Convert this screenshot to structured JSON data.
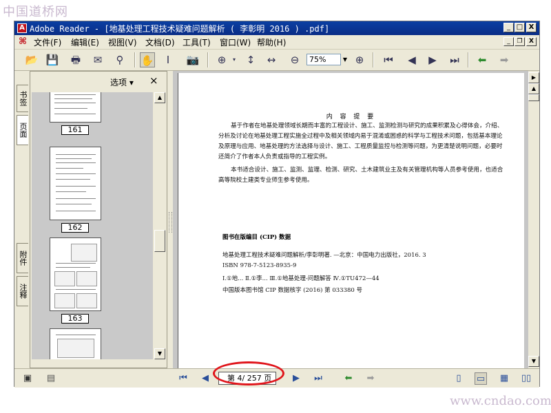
{
  "watermark": {
    "top": "中国道桥网",
    "bottom": "www.cndao.com"
  },
  "window": {
    "title": "Adobe Reader - [地基处理工程技术疑难问题解析 ( 李彰明 2016 ) .pdf]",
    "controls": {
      "minimize": "_",
      "maximize": "□",
      "close": "X"
    }
  },
  "menu": {
    "items": [
      "文件(F)",
      "编辑(E)",
      "视图(V)",
      "文档(D)",
      "工具(T)",
      "窗口(W)",
      "帮助(H)"
    ],
    "doc_controls": {
      "minimize": "_",
      "restore": "❐",
      "close": "X"
    }
  },
  "toolbar": {
    "zoom": "75%"
  },
  "side_tabs": {
    "bookmarks": "书签",
    "pages": "页面",
    "attachments": "附件",
    "comments": "注释"
  },
  "nav_panel": {
    "options_label": "选项 ▾",
    "close": "×",
    "thumbnails": [
      {
        "label": "161"
      },
      {
        "label": "162"
      },
      {
        "label": "163"
      }
    ]
  },
  "document": {
    "heading": "内 容 提 要",
    "paragraph1": "基于作者在地基处理领域长期而丰富的工程设计、施工、监测检测与研究的成果积累及心得体会，介绍、分析及讨论在地基处理工程实施全过程中及相关领域内易于混淆或困惑的科学与工程技术问题，包括基本理论及原理与应用、地基处理的方法选择与设计、施工、工程质量监控与检测等问题，为更清楚说明问题，必要时还简介了作者本人负责或指导的工程实例。",
    "paragraph2": "本书适合设计、施工、监测、监理、检测、研究、土木建筑业主及有关管理机构等人员参考使用，也适合高等院校土建类专业师生参考使用。",
    "cip": {
      "heading": "图书在版编目 (CIP) 数据",
      "line1": "地基处理工程技术疑难问题解析/李彰明著. —北京：中国电力出版社，2016. 3",
      "line2": "ISBN 978-7-5123-8935-9",
      "line3": "Ⅰ.①地...  Ⅱ.①李...  Ⅲ.①地基处理-问题解答  Ⅳ.①TU472—44",
      "line4": "中国版本图书馆 CIP 数据核字 (2016) 第 033380 号"
    }
  },
  "status": {
    "page_indicator": "第 4/ 257 页"
  }
}
